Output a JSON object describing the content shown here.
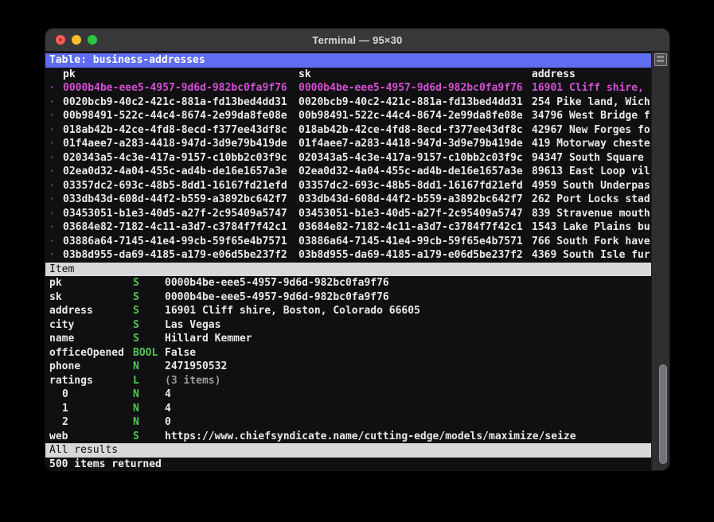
{
  "window": {
    "title": "Terminal — 95×30"
  },
  "table": {
    "title": "Table: business-addresses",
    "columns": [
      "pk",
      "sk",
      "address"
    ],
    "rows": [
      {
        "pk": "0000b4be-eee5-4957-9d6d-982bc0fa9f76",
        "sk": "0000b4be-eee5-4957-9d6d-982bc0fa9f76",
        "address": "16901 Cliff shire,",
        "selected": true
      },
      {
        "pk": "0020bcb9-40c2-421c-881a-fd13bed4dd31",
        "sk": "0020bcb9-40c2-421c-881a-fd13bed4dd31",
        "address": "254 Pike land, Wich",
        "selected": false
      },
      {
        "pk": "00b98491-522c-44c4-8674-2e99da8fe08e",
        "sk": "00b98491-522c-44c4-8674-2e99da8fe08e",
        "address": "34796 West Bridge f",
        "selected": false
      },
      {
        "pk": "018ab42b-42ce-4fd8-8ecd-f377ee43df8c",
        "sk": "018ab42b-42ce-4fd8-8ecd-f377ee43df8c",
        "address": "42967 New Forges fo",
        "selected": false
      },
      {
        "pk": "01f4aee7-a283-4418-947d-3d9e79b419de",
        "sk": "01f4aee7-a283-4418-947d-3d9e79b419de",
        "address": "419 Motorway cheste",
        "selected": false
      },
      {
        "pk": "020343a5-4c3e-417a-9157-c10bb2c03f9c",
        "sk": "020343a5-4c3e-417a-9157-c10bb2c03f9c",
        "address": "94347 South Square",
        "selected": false
      },
      {
        "pk": "02ea0d32-4a04-455c-ad4b-de16e1657a3e",
        "sk": "02ea0d32-4a04-455c-ad4b-de16e1657a3e",
        "address": "89613 East Loop vil",
        "selected": false
      },
      {
        "pk": "03357dc2-693c-48b5-8dd1-16167fd21efd",
        "sk": "03357dc2-693c-48b5-8dd1-16167fd21efd",
        "address": "4959 South Underpas",
        "selected": false
      },
      {
        "pk": "033db43d-608d-44f2-b559-a3892bc642f7",
        "sk": "033db43d-608d-44f2-b559-a3892bc642f7",
        "address": "262 Port Locks stad",
        "selected": false
      },
      {
        "pk": "03453051-b1e3-40d5-a27f-2c95409a5747",
        "sk": "03453051-b1e3-40d5-a27f-2c95409a5747",
        "address": "839 Stravenue mouth",
        "selected": false
      },
      {
        "pk": "03684e82-7182-4c11-a3d7-c3784f7f42c1",
        "sk": "03684e82-7182-4c11-a3d7-c3784f7f42c1",
        "address": "1543 Lake Plains bu",
        "selected": false
      },
      {
        "pk": "03886a64-7145-41e4-99cb-59f65e4b7571",
        "sk": "03886a64-7145-41e4-99cb-59f65e4b7571",
        "address": "766 South Fork have",
        "selected": false
      },
      {
        "pk": "03b8d955-da69-4185-a179-e06d5be237f2",
        "sk": "03b8d955-da69-4185-a179-e06d5be237f2",
        "address": "4369 South Isle fur",
        "selected": false
      }
    ]
  },
  "item": {
    "title": "Item",
    "attributes": [
      {
        "name": "pk",
        "type": "S",
        "value": "0000b4be-eee5-4957-9d6d-982bc0fa9f76",
        "indent": false,
        "muted": false
      },
      {
        "name": "sk",
        "type": "S",
        "value": "0000b4be-eee5-4957-9d6d-982bc0fa9f76",
        "indent": false,
        "muted": false
      },
      {
        "name": "address",
        "type": "S",
        "value": "16901 Cliff shire, Boston, Colorado 66605",
        "indent": false,
        "muted": false
      },
      {
        "name": "city",
        "type": "S",
        "value": "Las Vegas",
        "indent": false,
        "muted": false
      },
      {
        "name": "name",
        "type": "S",
        "value": "Hillard Kemmer",
        "indent": false,
        "muted": false
      },
      {
        "name": "officeOpened",
        "type": "BOOL",
        "value": "False",
        "indent": false,
        "muted": false
      },
      {
        "name": "phone",
        "type": "N",
        "value": "2471950532",
        "indent": false,
        "muted": false
      },
      {
        "name": "ratings",
        "type": "L",
        "value": "(3 items)",
        "indent": false,
        "muted": true
      },
      {
        "name": "0",
        "type": "N",
        "value": "4",
        "indent": true,
        "muted": false
      },
      {
        "name": "1",
        "type": "N",
        "value": "4",
        "indent": true,
        "muted": false
      },
      {
        "name": "2",
        "type": "N",
        "value": "0",
        "indent": true,
        "muted": false
      },
      {
        "name": "web",
        "type": "S",
        "value": "https://www.chiefsyndicate.name/cutting-edge/models/maximize/seize",
        "indent": false,
        "muted": false
      }
    ]
  },
  "footer": {
    "results_label": "All results",
    "status": "500 items returned"
  },
  "icons": {
    "row_bullet": "·",
    "split_pane_button": "split-pane-icon"
  },
  "colors": {
    "accent_blue": "#5e6df2",
    "selected_magenta": "#d24fd2",
    "type_green": "#4fc94f",
    "bar_gray": "#d8d8d8",
    "term_bg": "#101013",
    "titlebar_bg": "#38383a",
    "text": "#e9e9e9",
    "muted": "#9a9a9a",
    "traffic_red": "#ff5f57",
    "traffic_yellow": "#febc2e",
    "traffic_green": "#28c840"
  }
}
